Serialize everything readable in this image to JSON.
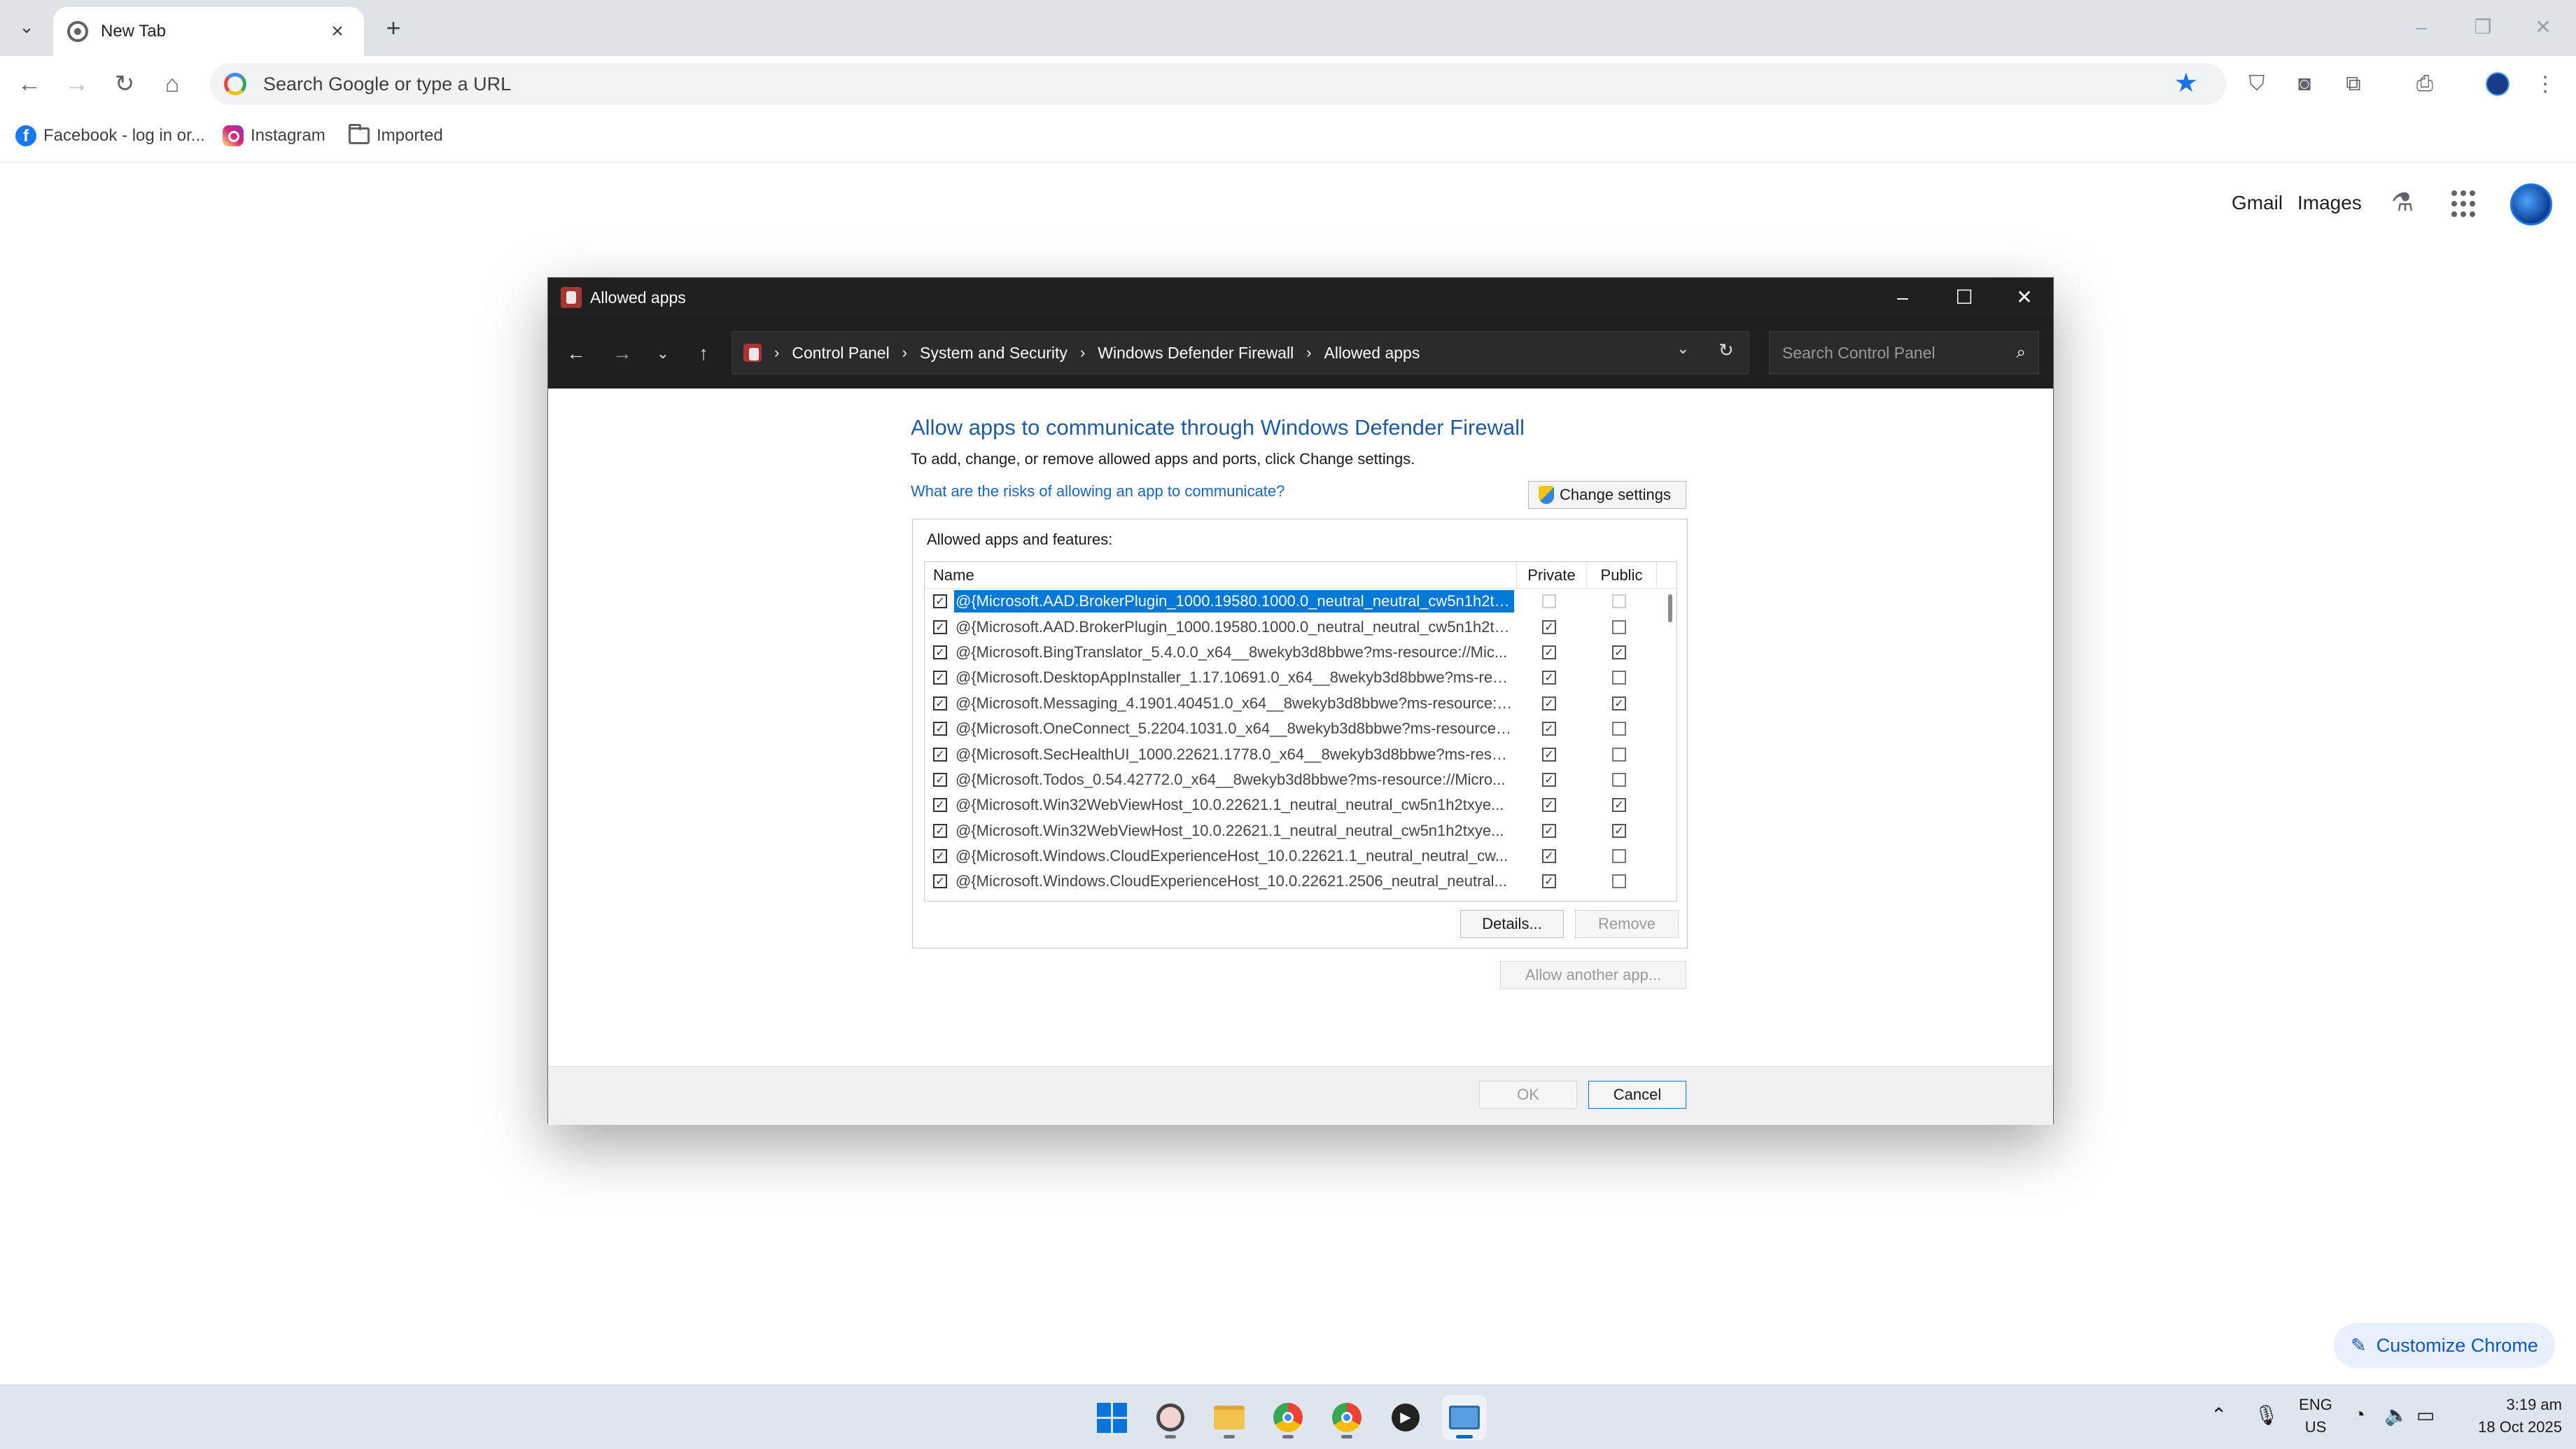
{
  "browser": {
    "tab_title": "New Tab",
    "omnibox_placeholder": "Search Google or type a URL",
    "bookmarks": [
      {
        "label": "Facebook - log in or..."
      },
      {
        "label": "Instagram"
      },
      {
        "label": "Imported"
      }
    ],
    "ntp_links": {
      "gmail": "Gmail",
      "images": "Images"
    },
    "customize_label": "Customize Chrome",
    "accent_color": "#1a73e8"
  },
  "dialog": {
    "title": "Allowed apps",
    "breadcrumbs": [
      "Control Panel",
      "System and Security",
      "Windows Defender Firewall",
      "Allowed apps"
    ],
    "search_placeholder": "Search Control Panel",
    "heading": "Allow apps to communicate through Windows Defender Firewall",
    "subtext": "To add, change, or remove allowed apps and ports, click Change settings.",
    "risk_link": "What are the risks of allowing an app to communicate?",
    "change_settings": "Change settings",
    "group_label": "Allowed apps and features:",
    "columns": {
      "name": "Name",
      "private": "Private",
      "public": "Public"
    },
    "rows": [
      {
        "name": "@{Microsoft.AAD.BrokerPlugin_1000.19580.1000.0_neutral_neutral_cw5n1h2tx...",
        "enabled": true,
        "private": false,
        "public": false,
        "selected": true
      },
      {
        "name": "@{Microsoft.AAD.BrokerPlugin_1000.19580.1000.0_neutral_neutral_cw5n1h2tx...",
        "enabled": true,
        "private": true,
        "public": false
      },
      {
        "name": "@{Microsoft.BingTranslator_5.4.0.0_x64__8wekyb3d8bbwe?ms-resource://Mic...",
        "enabled": true,
        "private": true,
        "public": true
      },
      {
        "name": "@{Microsoft.DesktopAppInstaller_1.17.10691.0_x64__8wekyb3d8bbwe?ms-res...",
        "enabled": true,
        "private": true,
        "public": false
      },
      {
        "name": "@{Microsoft.Messaging_4.1901.40451.0_x64__8wekyb3d8bbwe?ms-resource:/...",
        "enabled": true,
        "private": true,
        "public": true
      },
      {
        "name": "@{Microsoft.OneConnect_5.2204.1031.0_x64__8wekyb3d8bbwe?ms-resource:...",
        "enabled": true,
        "private": true,
        "public": false
      },
      {
        "name": "@{Microsoft.SecHealthUI_1000.22621.1778.0_x64__8wekyb3d8bbwe?ms-resou...",
        "enabled": true,
        "private": true,
        "public": false
      },
      {
        "name": "@{Microsoft.Todos_0.54.42772.0_x64__8wekyb3d8bbwe?ms-resource://Micro...",
        "enabled": true,
        "private": true,
        "public": false
      },
      {
        "name": "@{Microsoft.Win32WebViewHost_10.0.22621.1_neutral_neutral_cw5n1h2txye...",
        "enabled": true,
        "private": true,
        "public": true
      },
      {
        "name": "@{Microsoft.Win32WebViewHost_10.0.22621.1_neutral_neutral_cw5n1h2txye...",
        "enabled": true,
        "private": true,
        "public": true
      },
      {
        "name": "@{Microsoft.Windows.CloudExperienceHost_10.0.22621.1_neutral_neutral_cw...",
        "enabled": true,
        "private": true,
        "public": false
      },
      {
        "name": "@{Microsoft.Windows.CloudExperienceHost_10.0.22621.2506_neutral_neutral...",
        "enabled": true,
        "private": true,
        "public": false
      }
    ],
    "details_btn": "Details...",
    "remove_btn": "Remove",
    "allow_another_btn": "Allow another app...",
    "ok_btn": "OK",
    "cancel_btn": "Cancel",
    "link_color": "#1668c4",
    "selection_color": "#0078d7"
  },
  "taskbar": {
    "lang_top": "ENG",
    "lang_bottom": "US",
    "time": "3:19 am",
    "date": "18 Oct 2025"
  }
}
